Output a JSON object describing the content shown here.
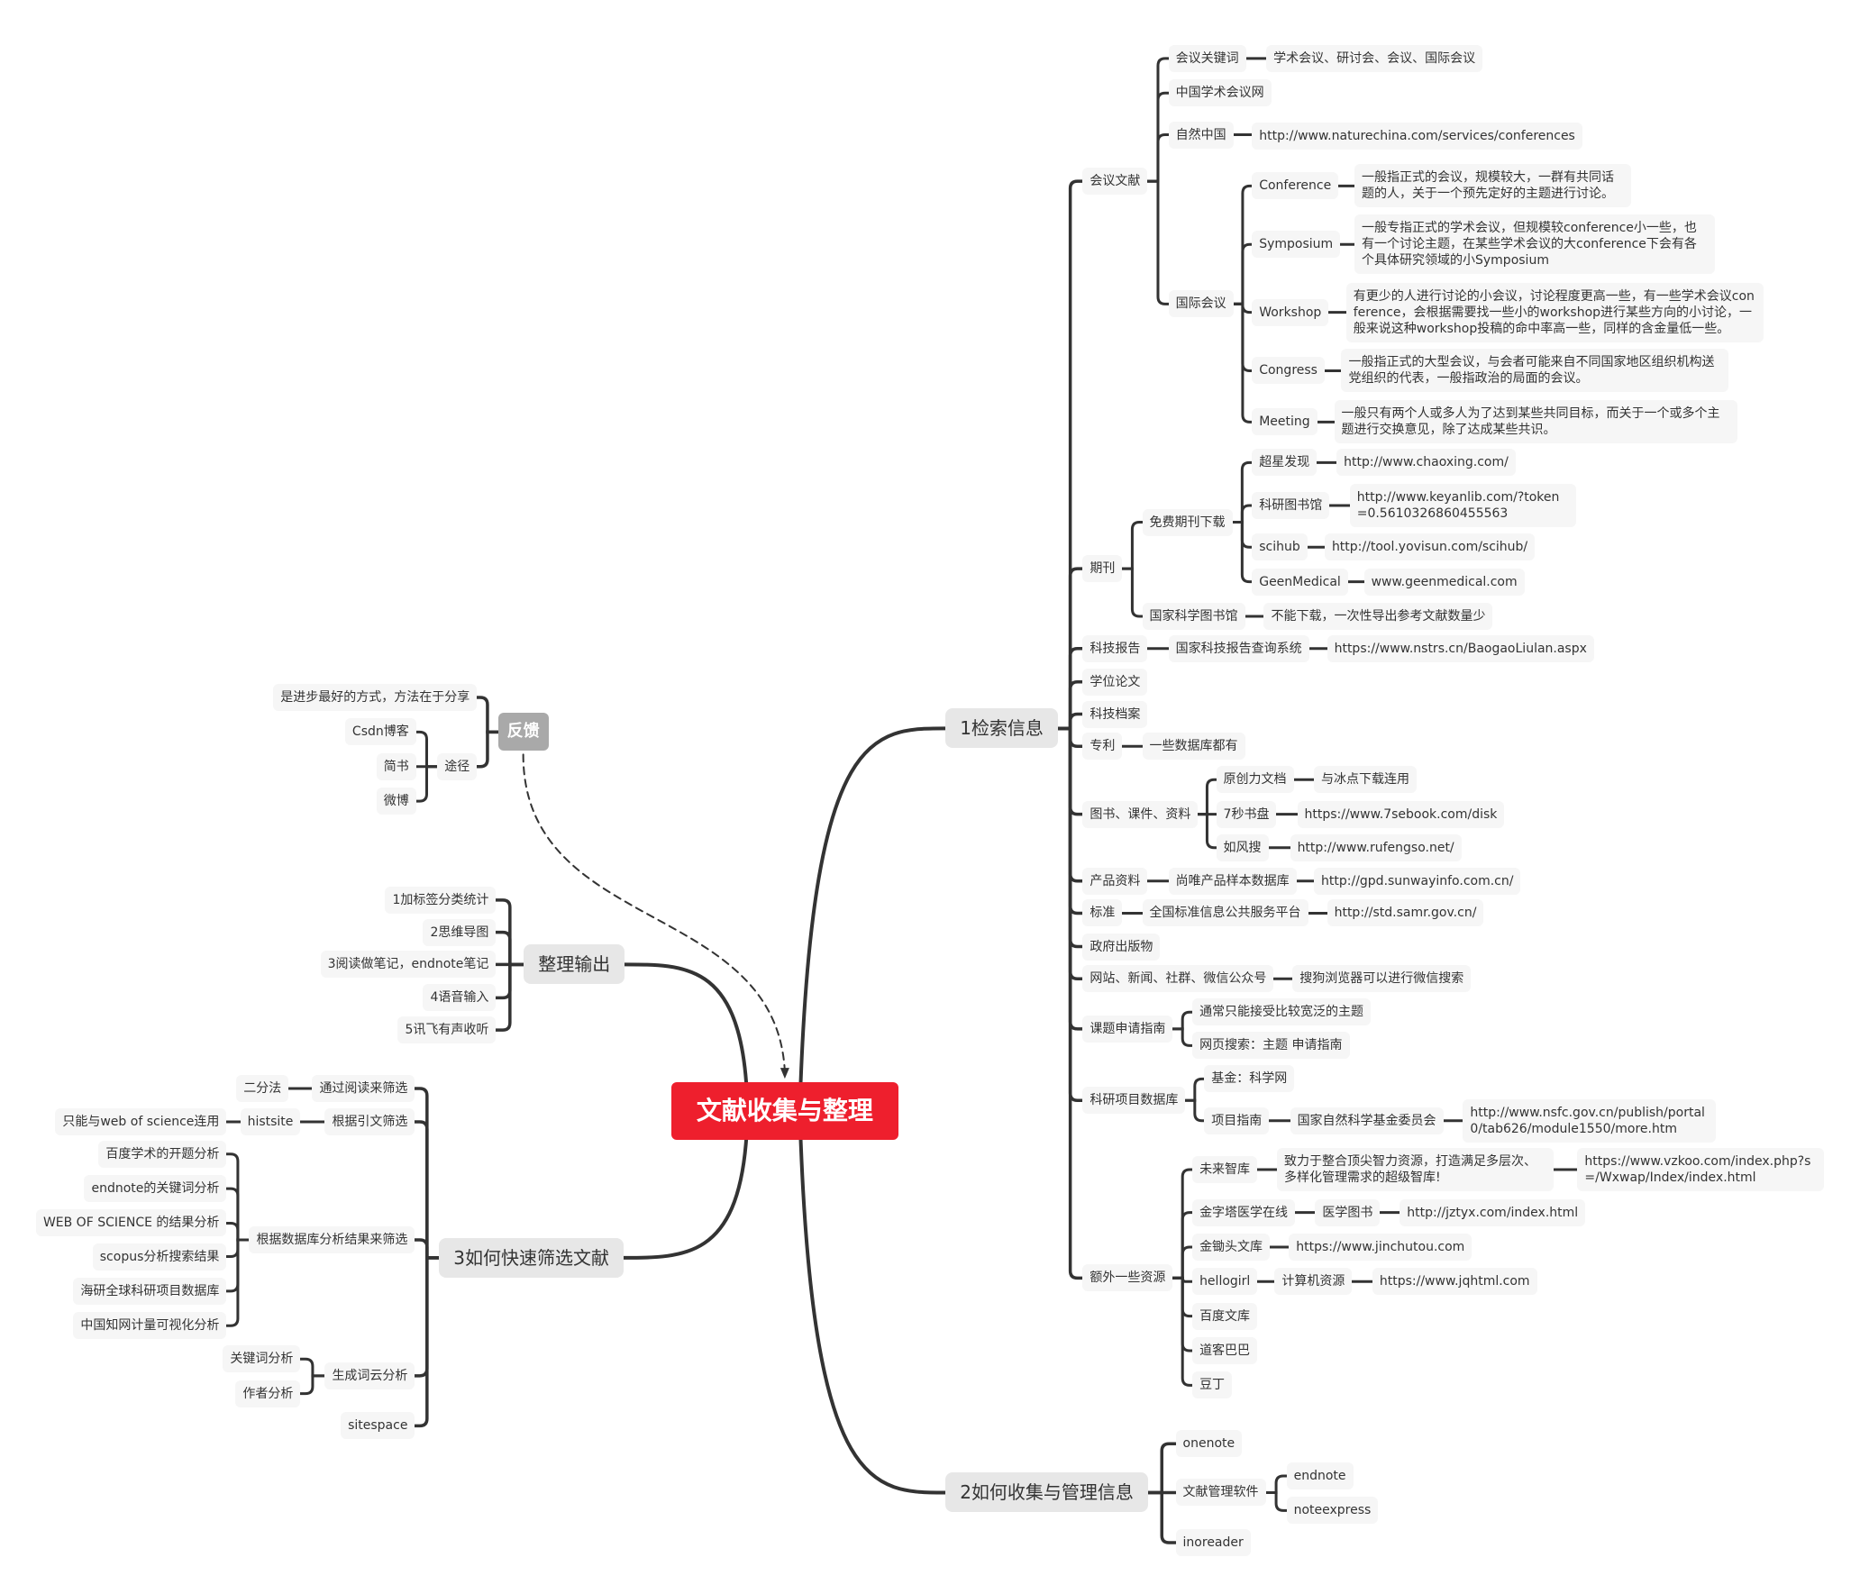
{
  "map": {
    "root": {
      "label": "文献收集与整理",
      "color": "#ee1f2d",
      "children": [
        {
          "label": "1检索信息",
          "children": [
            {
              "label": "会议文献",
              "children": [
                {
                  "label": "会议关键词",
                  "children": [
                    {
                      "label": "学术会议、研讨会、会议、国际会议"
                    }
                  ]
                },
                {
                  "label": "中国学术会议网"
                },
                {
                  "label": "自然中国",
                  "children": [
                    {
                      "label": "http://www.naturechina.com/services/conferences"
                    }
                  ]
                },
                {
                  "label": "国际会议",
                  "children": [
                    {
                      "label": "Conference",
                      "children": [
                        {
                          "label": "一般指正式的会议，规模较大，一群有共同话题的人，关于一个预先定好的主题进行讨论。"
                        }
                      ]
                    },
                    {
                      "label": "Symposium",
                      "children": [
                        {
                          "label": "一般专指正式的学术会议，但规模较conference小一些，也有一个讨论主题，在某些学术会议的大conference下会有各个具体研究领域的小Symposium"
                        }
                      ]
                    },
                    {
                      "label": "Workshop",
                      "children": [
                        {
                          "label": "有更少的人进行讨论的小会议，讨论程度更高一些，有一些学术会议conference，会根据需要找一些小的workshop进行某些方向的小讨论，一般来说这种workshop投稿的命中率高一些，同样的含金量低一些。"
                        }
                      ]
                    },
                    {
                      "label": "Congress",
                      "children": [
                        {
                          "label": "一般指正式的大型会议，与会者可能来自不同国家地区组织机构送党组织的代表，一般指政治的局面的会议。"
                        }
                      ]
                    },
                    {
                      "label": "Meeting",
                      "children": [
                        {
                          "label": "一般只有两个人或多人为了达到某些共同目标，而关于一个或多个主题进行交换意见，除了达成某些共识。"
                        }
                      ]
                    }
                  ]
                }
              ]
            },
            {
              "label": "期刊",
              "children": [
                {
                  "label": "免费期刊下载",
                  "children": [
                    {
                      "label": "超星发现",
                      "children": [
                        {
                          "label": "http://www.chaoxing.com/"
                        }
                      ]
                    },
                    {
                      "label": "科研图书馆",
                      "children": [
                        {
                          "label": "http://www.keyanlib.com/?token=0.5610326860455563"
                        }
                      ]
                    },
                    {
                      "label": "scihub",
                      "children": [
                        {
                          "label": "http://tool.yovisun.com/scihub/"
                        }
                      ]
                    },
                    {
                      "label": "GeenMedical",
                      "children": [
                        {
                          "label": "www.geenmedical.com"
                        }
                      ]
                    }
                  ]
                },
                {
                  "label": "国家科学图书馆",
                  "children": [
                    {
                      "label": "不能下载，一次性导出参考文献数量少"
                    }
                  ]
                }
              ]
            },
            {
              "label": "科技报告",
              "children": [
                {
                  "label": "国家科技报告查询系统",
                  "children": [
                    {
                      "label": "https://www.nstrs.cn/BaogaoLiulan.aspx"
                    }
                  ]
                }
              ]
            },
            {
              "label": "学位论文"
            },
            {
              "label": "科技档案"
            },
            {
              "label": "专利",
              "children": [
                {
                  "label": "一些数据库都有"
                }
              ]
            },
            {
              "label": "图书、课件、资料",
              "children": [
                {
                  "label": "原创力文档",
                  "children": [
                    {
                      "label": "与冰点下载连用"
                    }
                  ]
                },
                {
                  "label": "7秒书盘",
                  "children": [
                    {
                      "label": "https://www.7sebook.com/disk"
                    }
                  ]
                },
                {
                  "label": "如风搜",
                  "children": [
                    {
                      "label": "http://www.rufengso.net/"
                    }
                  ]
                }
              ]
            },
            {
              "label": "产品资料",
              "children": [
                {
                  "label": "尚唯产品样本数据库",
                  "children": [
                    {
                      "label": "http://gpd.sunwayinfo.com.cn/"
                    }
                  ]
                }
              ]
            },
            {
              "label": "标准",
              "children": [
                {
                  "label": "全国标准信息公共服务平台",
                  "children": [
                    {
                      "label": "http://std.samr.gov.cn/"
                    }
                  ]
                }
              ]
            },
            {
              "label": "政府出版物"
            },
            {
              "label": "网站、新闻、社群、微信公众号",
              "children": [
                {
                  "label": "搜狗浏览器可以进行微信搜索"
                }
              ]
            },
            {
              "label": "课题申请指南",
              "children": [
                {
                  "label": "通常只能接受比较宽泛的主题"
                },
                {
                  "label": "网页搜索：主题  申请指南"
                }
              ]
            },
            {
              "label": "科研项目数据库",
              "children": [
                {
                  "label": "基金：科学网"
                },
                {
                  "label": "项目指南",
                  "children": [
                    {
                      "label": "国家自然科学基金委员会",
                      "children": [
                        {
                          "label": "http://www.nsfc.gov.cn/publish/portal0/tab626/module1550/more.htm"
                        }
                      ]
                    }
                  ]
                }
              ]
            },
            {
              "label": "额外一些资源",
              "children": [
                {
                  "label": "未来智库",
                  "children": [
                    {
                      "label": "致力于整合顶尖智力资源，打造满足多层次、多样化管理需求的超级智库!",
                      "children": [
                        {
                          "label": "https://www.vzkoo.com/index.php?s=/Wxwap/Index/index.html"
                        }
                      ]
                    }
                  ]
                },
                {
                  "label": "金字塔医学在线",
                  "children": [
                    {
                      "label": "医学图书",
                      "children": [
                        {
                          "label": "http://jztyx.com/index.html"
                        }
                      ]
                    }
                  ]
                },
                {
                  "label": "金锄头文库",
                  "children": [
                    {
                      "label": "https://www.jinchutou.com"
                    }
                  ]
                },
                {
                  "label": "hellogirl",
                  "children": [
                    {
                      "label": "计算机资源",
                      "children": [
                        {
                          "label": "https://www.jqhtml.com"
                        }
                      ]
                    }
                  ]
                },
                {
                  "label": "百度文库"
                },
                {
                  "label": "道客巴巴"
                },
                {
                  "label": "豆丁"
                }
              ]
            }
          ]
        },
        {
          "label": "2如何收集与管理信息",
          "children": [
            {
              "label": "onenote"
            },
            {
              "label": "文献管理软件",
              "children": [
                {
                  "label": "endnote"
                },
                {
                  "label": "noteexpress"
                }
              ]
            },
            {
              "label": "inoreader"
            }
          ]
        },
        {
          "label": "整理输出",
          "children": [
            {
              "label": "1加标签分类统计"
            },
            {
              "label": "2思维导图"
            },
            {
              "label": "3阅读做笔记，endnote笔记"
            },
            {
              "label": "4语音输入"
            },
            {
              "label": "5讯飞有声收听"
            }
          ]
        },
        {
          "label": "3如何快速筛选文献",
          "children": [
            {
              "label": "通过阅读来筛选",
              "children": [
                {
                  "label": "二分法"
                }
              ]
            },
            {
              "label": "根据引文筛选",
              "children": [
                {
                  "label": "histsite",
                  "children": [
                    {
                      "label": "只能与web of science连用"
                    }
                  ]
                }
              ]
            },
            {
              "label": "根据数据库分析结果来筛选",
              "children": [
                {
                  "label": "百度学术的开题分析"
                },
                {
                  "label": "endnote的关键词分析"
                },
                {
                  "label": "WEB OF SCIENCE 的结果分析"
                },
                {
                  "label": "scopus分析搜索结果"
                },
                {
                  "label": "海研全球科研项目数据库"
                },
                {
                  "label": "中国知网计量可视化分析"
                }
              ]
            },
            {
              "label": "生成词云分析",
              "children": [
                {
                  "label": "关键词分析"
                },
                {
                  "label": "作者分析"
                }
              ]
            },
            {
              "label": "sitespace"
            }
          ]
        },
        {
          "label": "反馈",
          "color": "#a9a9a9",
          "children": [
            {
              "label": "是进步最好的方式，方法在于分享"
            },
            {
              "label": "途径",
              "children": [
                {
                  "label": "Csdn博客"
                },
                {
                  "label": "简书"
                },
                {
                  "label": "微博"
                }
              ]
            }
          ]
        }
      ]
    },
    "line_color": "#333333"
  }
}
